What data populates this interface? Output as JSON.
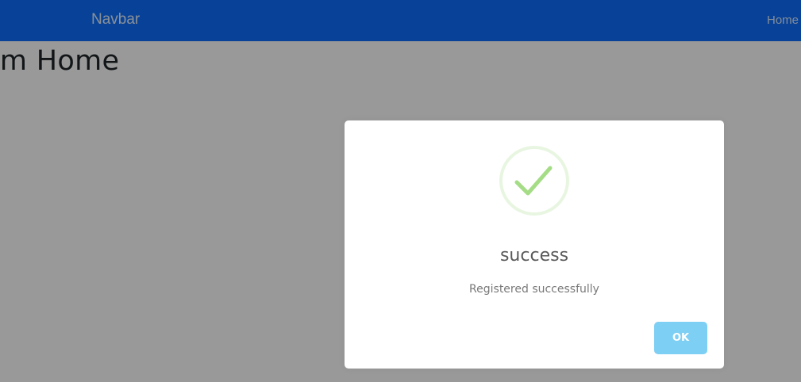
{
  "navbar": {
    "brand": "Navbar",
    "links": [
      "Home"
    ],
    "color": "#0d6efd"
  },
  "page": {
    "heading": "'m Home"
  },
  "dialog": {
    "icon": "success-check-icon",
    "title": "success",
    "message": "Registered successfully",
    "confirm_label": "OK",
    "confirm_color": "#7ecff4",
    "icon_color": "#a5dc86"
  }
}
